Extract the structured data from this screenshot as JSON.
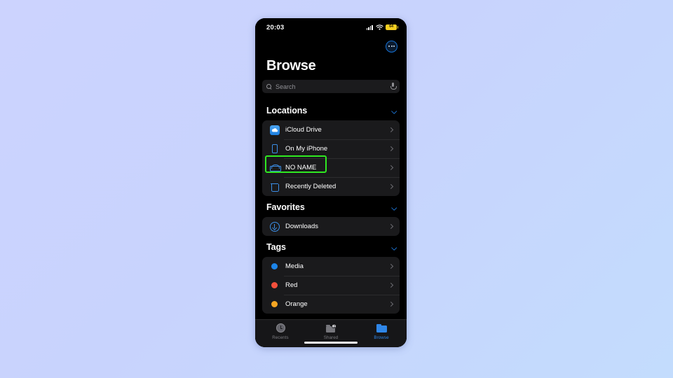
{
  "status_bar": {
    "time": "20:03",
    "cellular_icon": "cellular-bars-icon",
    "wifi_icon": "wifi-icon",
    "battery_icon": "battery-icon",
    "battery_level": "64",
    "battery_color": "#f5cf21"
  },
  "nav": {
    "more_button_label": "more-options",
    "more_icon": "ellipsis-circle-icon"
  },
  "header": {
    "title": "Browse"
  },
  "search": {
    "placeholder": "Search",
    "value": "",
    "search_icon": "search-icon",
    "mic_icon": "microphone-icon"
  },
  "accent_color": "#2f86e8",
  "highlight_color": "#2fe821",
  "sections": [
    {
      "title": "Locations",
      "collapse_icon": "chevron-down-icon",
      "items": [
        {
          "label": "iCloud Drive",
          "icon": "icloud-drive-icon",
          "disclosure": "chevron-right-icon",
          "highlighted": false
        },
        {
          "label": "On My iPhone",
          "icon": "iphone-icon",
          "disclosure": "chevron-right-icon",
          "highlighted": false
        },
        {
          "label": "NO NAME",
          "icon": "external-drive-icon",
          "disclosure": "chevron-right-icon",
          "highlighted": true
        },
        {
          "label": "Recently Deleted",
          "icon": "trash-icon",
          "disclosure": "chevron-right-icon",
          "highlighted": false
        }
      ]
    },
    {
      "title": "Favorites",
      "collapse_icon": "chevron-down-icon",
      "items": [
        {
          "label": "Downloads",
          "icon": "download-circle-icon",
          "disclosure": "chevron-right-icon",
          "highlighted": false
        }
      ]
    },
    {
      "title": "Tags",
      "collapse_icon": "chevron-down-icon",
      "items": [
        {
          "label": "Media",
          "icon": "tag-dot-icon",
          "dot_color": "#1c84e8",
          "disclosure": "chevron-right-icon",
          "highlighted": false
        },
        {
          "label": "Red",
          "icon": "tag-dot-icon",
          "dot_color": "#f4503c",
          "disclosure": "chevron-right-icon",
          "highlighted": false
        },
        {
          "label": "Orange",
          "icon": "tag-dot-icon",
          "dot_color": "#f5a623",
          "disclosure": "chevron-right-icon",
          "highlighted": false
        }
      ]
    }
  ],
  "tab_bar": {
    "tabs": [
      {
        "label": "Recents",
        "icon": "clock-icon",
        "active": false
      },
      {
        "label": "Shared",
        "icon": "shared-folder-icon",
        "active": false
      },
      {
        "label": "Browse",
        "icon": "folder-icon",
        "active": true
      }
    ]
  }
}
